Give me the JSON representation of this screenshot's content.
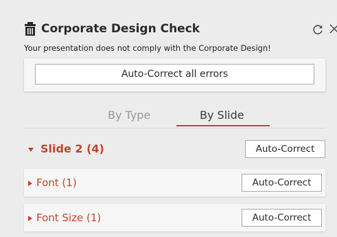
{
  "header": {
    "title": "Corporate Design Check",
    "subtitle": "Your presentation does not comply with the Corporate Design!",
    "refresh_icon": "refresh-icon",
    "close_icon": "close-icon"
  },
  "autocorrect_all_label": "Auto-Correct all errors",
  "tabs": [
    {
      "label": "By Type",
      "active": false
    },
    {
      "label": "By Slide",
      "active": true
    }
  ],
  "slide_group": {
    "label": "Slide 2 (4)",
    "button_label": "Auto-Correct",
    "expanded": true
  },
  "items": [
    {
      "label": "Font (1)",
      "button_label": "Auto-Correct",
      "expanded": false
    },
    {
      "label": "Font Size (1)",
      "button_label": "Auto-Correct",
      "expanded": false
    }
  ],
  "colors": {
    "accent": "#c0462b",
    "background": "#ececec",
    "card": "#f6f6f6",
    "text": "#2a2a2a",
    "tab_inactive": "#9a9a9a"
  }
}
